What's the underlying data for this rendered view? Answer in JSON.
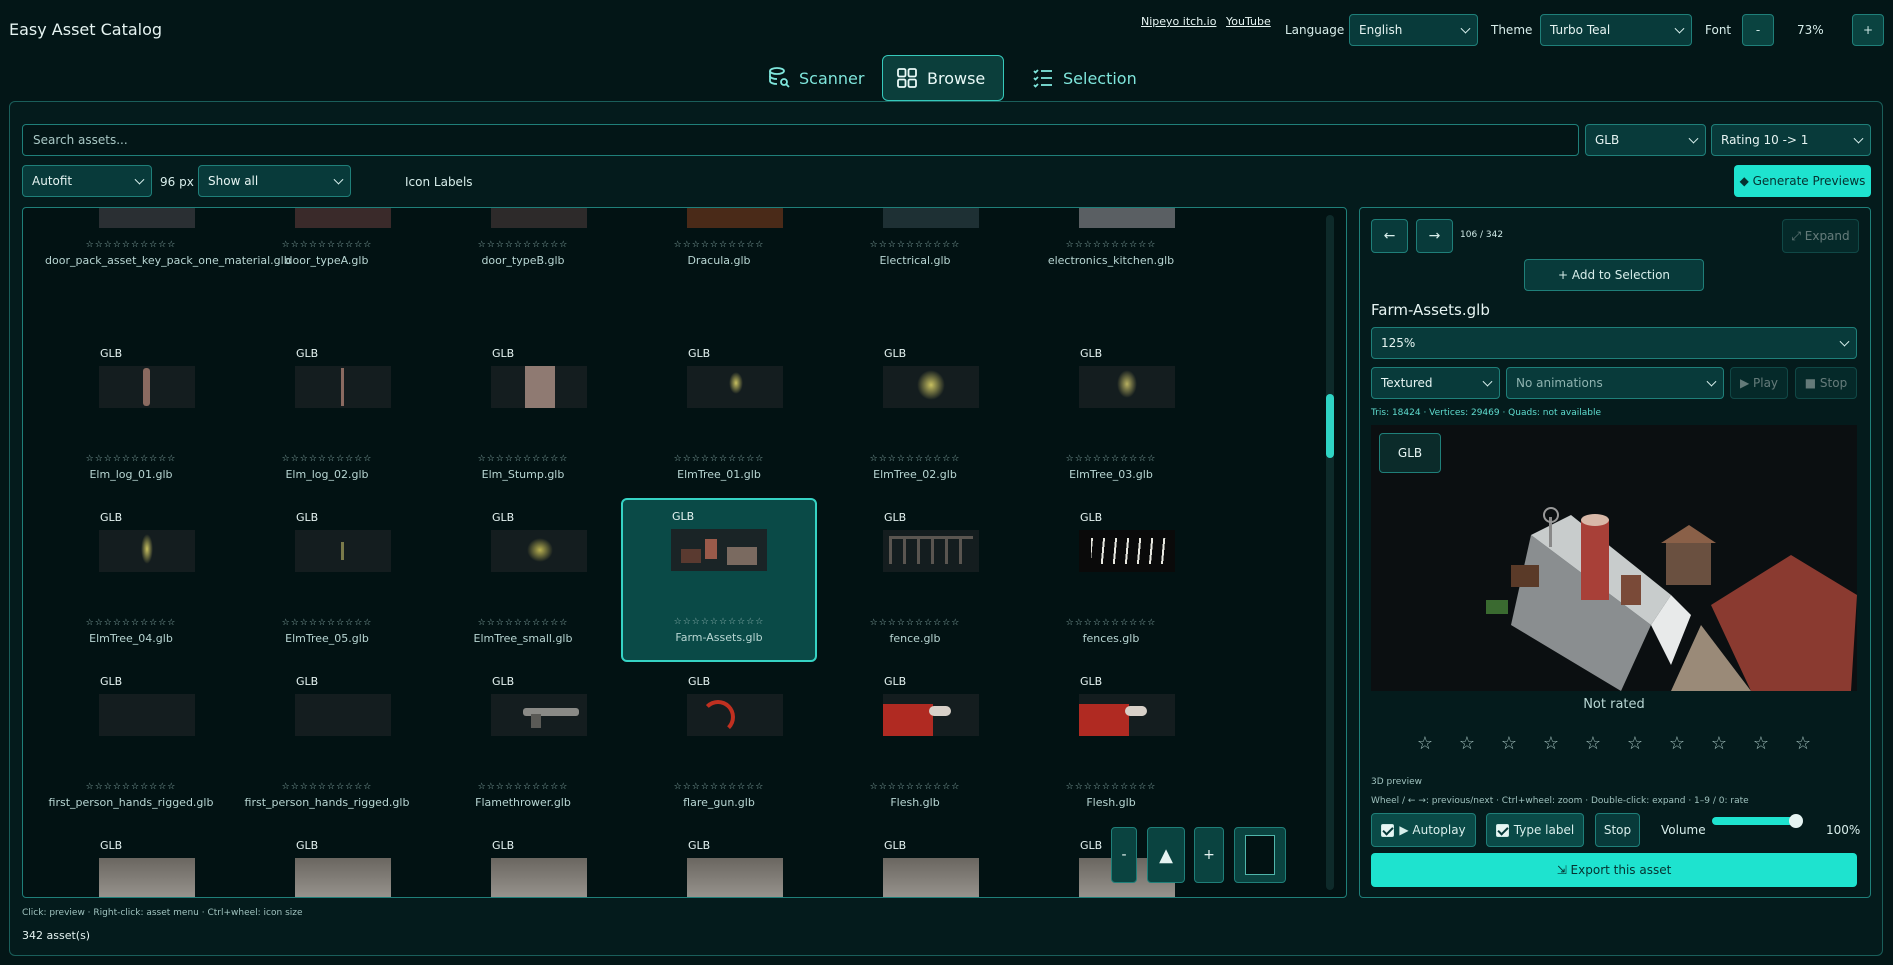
{
  "app": {
    "title": "Easy Asset Catalog"
  },
  "header": {
    "links": [
      "Nipeyo itch.io",
      "YouTube"
    ],
    "language_label": "Language",
    "language_value": "English",
    "theme_label": "Theme",
    "theme_value": "Turbo Teal",
    "font_label": "Font",
    "font_minus": "-",
    "font_value": "73%",
    "font_plus": "+"
  },
  "tabs": [
    {
      "label": "Scanner",
      "icon": "database-search-icon",
      "active": false
    },
    {
      "label": "Browse",
      "icon": "grid-icon",
      "active": true
    },
    {
      "label": "Selection",
      "icon": "checklist-icon",
      "active": false
    }
  ],
  "toolbar": {
    "search_placeholder": "Search assets...",
    "type_filter": "GLB",
    "sort": "Rating 10 -> 1",
    "layout": "Autofit",
    "icon_size": "96 px",
    "show": "Show all",
    "icon_labels": "Icon Labels",
    "generate": "◆ Generate Previews"
  },
  "grid": {
    "stars": "☆☆☆☆☆☆☆☆☆☆",
    "partial_row": [
      "door_pack_asset_key_pack_one_material.glb",
      "door_typeA.glb",
      "door_typeB.glb",
      "Dracula.glb",
      "Electrical.glb",
      "electronics_kitchen.glb"
    ],
    "rows": [
      [
        {
          "type": "GLB",
          "name": "Elm_log_01.glb"
        },
        {
          "type": "GLB",
          "name": "Elm_log_02.glb"
        },
        {
          "type": "GLB",
          "name": "Elm_Stump.glb"
        },
        {
          "type": "GLB",
          "name": "ElmTree_01.glb"
        },
        {
          "type": "GLB",
          "name": "ElmTree_02.glb"
        },
        {
          "type": "GLB",
          "name": "ElmTree_03.glb"
        }
      ],
      [
        {
          "type": "GLB",
          "name": "ElmTree_04.glb"
        },
        {
          "type": "GLB",
          "name": "ElmTree_05.glb"
        },
        {
          "type": "GLB",
          "name": "ElmTree_small.glb"
        },
        {
          "type": "GLB",
          "name": "Farm-Assets.glb"
        },
        {
          "type": "GLB",
          "name": "fence.glb"
        },
        {
          "type": "GLB",
          "name": "fences.glb"
        }
      ],
      [
        {
          "type": "GLB",
          "name": "first_person_hands_rigged.glb"
        },
        {
          "type": "GLB",
          "name": "first_person_hands_rigged.glb"
        },
        {
          "type": "GLB",
          "name": "Flamethrower.glb"
        },
        {
          "type": "GLB",
          "name": "flare_gun.glb"
        },
        {
          "type": "GLB",
          "name": "Flesh.glb"
        },
        {
          "type": "GLB",
          "name": "Flesh.glb"
        }
      ],
      [
        {
          "type": "GLB",
          "name": ""
        },
        {
          "type": "GLB",
          "name": ""
        },
        {
          "type": "GLB",
          "name": ""
        },
        {
          "type": "GLB",
          "name": ""
        },
        {
          "type": "GLB",
          "name": ""
        },
        {
          "type": "GLB",
          "name": ""
        }
      ]
    ],
    "float_controls": [
      "-",
      "▲",
      "+"
    ]
  },
  "footer": {
    "hint": "Click: preview · Right-click: asset menu · Ctrl+wheel: icon size",
    "count": "342 asset(s)"
  },
  "preview": {
    "prev": "←",
    "next": "→",
    "position": "106 / 342",
    "expand": "⤢ Expand",
    "add_selection": "+ Add to Selection",
    "asset_name": "Farm-Assets.glb",
    "zoom": "125%",
    "shading": "Textured",
    "animations": "No animations",
    "play": "▶ Play",
    "stop": "■ Stop",
    "stats": "Tris: 18424 · Vertices: 29469 · Quads: not available",
    "badge": "GLB",
    "rating_text": "Not rated",
    "rating_stars": [
      "☆",
      "☆",
      "☆",
      "☆",
      "☆",
      "☆",
      "☆",
      "☆",
      "☆",
      "☆"
    ],
    "mode": "3D preview",
    "keys_hint": "Wheel / ← →: previous/next · Ctrl+wheel: zoom · Double-click: expand · 1–9 / 0: rate",
    "autoplay": "▶ Autoplay",
    "type_label": "Type label",
    "stop_btn": "Stop",
    "volume_label": "Volume",
    "volume_value": "100%",
    "volume_level": 1.0,
    "export": "⇲ Export this asset"
  },
  "colors": {
    "accent": "#1ee3cf",
    "background": "#031617",
    "border": "#1f7f79"
  }
}
